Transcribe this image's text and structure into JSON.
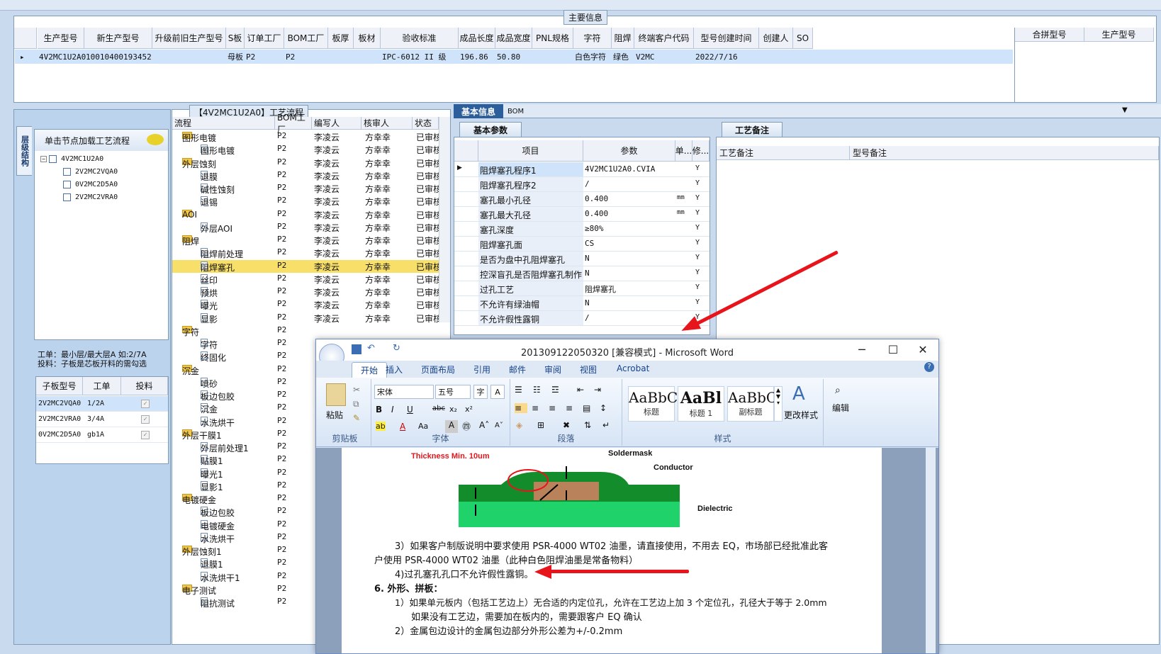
{
  "main_info": {
    "title": "主要信息",
    "columns": [
      "生产型号",
      "新生产型号",
      "升级前旧生产型号",
      "S板",
      "订单工厂",
      "BOM工厂",
      "板厚",
      "板材",
      "验收标准",
      "成品长度",
      "成品宽度",
      "PNL规格",
      "字符",
      "阻焊",
      "终端客户代码",
      "型号创建时间",
      "创建人",
      "SO"
    ],
    "row": {
      "marker": "▸",
      "生产型号": "4V2MC1U2A0",
      "新生产型号": "10010400193452",
      "S板": "母板",
      "订单工厂": "P2",
      "BOM工厂": "P2",
      "验收标准": "IPC-6012 II 级",
      "成品长度": "196.86",
      "成品宽度": "50.80",
      "字符": "白色字符",
      "阻焊": "绿色",
      "终端客户代码": "V2MC",
      "型号创建时间": "2022/7/16"
    },
    "right_columns": [
      "合拼型号",
      "生产型号"
    ]
  },
  "left": {
    "vertical_tab": "层级结构",
    "tree_header": "单击节点加载工艺流程",
    "tree": [
      "4V2MC1U2A0",
      "2V2MC2VQA0",
      "0V2MC2D5A0",
      "2V2MC2VRA0"
    ],
    "info_line1": "工单：最小层/最大层A 如:2/7A",
    "info_line2": "投料：子板是芯板开料的需勾选",
    "son_columns": [
      "子板型号",
      "工单",
      "投料"
    ],
    "son_rows": [
      {
        "model": "2V2MC2VQA0",
        "order": "1/2A",
        "check": "✓"
      },
      {
        "model": "2V2MC2VRA0",
        "order": "3/4A",
        "check": "✓"
      },
      {
        "model": "0V2MC2D5A0",
        "order": "gb1A",
        "check": "✓"
      }
    ]
  },
  "flow": {
    "title": "【4V2MC1U2A0】工艺流程",
    "columns": [
      "流程",
      "BOM工厂",
      "编写人",
      "核审人",
      "状态"
    ],
    "rows": [
      {
        "type": "folder",
        "name": "图形电镀",
        "bom": "P2",
        "writer": "李凌云",
        "reviewer": "方幸幸",
        "status": "已审核"
      },
      {
        "type": "doc",
        "name": "图形电镀",
        "bom": "P2",
        "writer": "李凌云",
        "reviewer": "方幸幸",
        "status": "已审核"
      },
      {
        "type": "folder",
        "name": "外层蚀刻",
        "bom": "P2",
        "writer": "李凌云",
        "reviewer": "方幸幸",
        "status": "已审核"
      },
      {
        "type": "doc",
        "name": "退膜",
        "bom": "P2",
        "writer": "李凌云",
        "reviewer": "方幸幸",
        "status": "已审核"
      },
      {
        "type": "doc",
        "name": "碱性蚀刻",
        "bom": "P2",
        "writer": "李凌云",
        "reviewer": "方幸幸",
        "status": "已审核"
      },
      {
        "type": "doc",
        "name": "退锡",
        "bom": "P2",
        "writer": "李凌云",
        "reviewer": "方幸幸",
        "status": "已审核"
      },
      {
        "type": "folder",
        "name": "AOI",
        "bom": "P2",
        "writer": "李凌云",
        "reviewer": "方幸幸",
        "status": "已审核"
      },
      {
        "type": "doc",
        "name": "外层AOI",
        "bom": "P2",
        "writer": "李凌云",
        "reviewer": "方幸幸",
        "status": "已审核"
      },
      {
        "type": "folder",
        "name": "阻焊",
        "bom": "P2",
        "writer": "李凌云",
        "reviewer": "方幸幸",
        "status": "已审核"
      },
      {
        "type": "doc",
        "name": "阻焊前处理",
        "bom": "P2",
        "writer": "李凌云",
        "reviewer": "方幸幸",
        "status": "已审核"
      },
      {
        "type": "doc",
        "name": "阻焊塞孔",
        "bom": "P2",
        "writer": "李凌云",
        "reviewer": "方幸幸",
        "status": "已审核",
        "selected": true
      },
      {
        "type": "doc",
        "name": "丝印",
        "bom": "P2",
        "writer": "李凌云",
        "reviewer": "方幸幸",
        "status": "已审核"
      },
      {
        "type": "doc",
        "name": "预烘",
        "bom": "P2",
        "writer": "李凌云",
        "reviewer": "方幸幸",
        "status": "已审核"
      },
      {
        "type": "doc",
        "name": "曝光",
        "bom": "P2",
        "writer": "李凌云",
        "reviewer": "方幸幸",
        "status": "已审核"
      },
      {
        "type": "doc",
        "name": "显影",
        "bom": "P2",
        "writer": "李凌云",
        "reviewer": "方幸幸",
        "status": "已审核"
      },
      {
        "type": "folder",
        "name": "字符",
        "bom": "P2"
      },
      {
        "type": "doc",
        "name": "字符",
        "bom": "P2"
      },
      {
        "type": "doc",
        "name": "终固化",
        "bom": "P2"
      },
      {
        "type": "folder",
        "name": "沉金",
        "bom": "P2"
      },
      {
        "type": "doc",
        "name": "喷砂",
        "bom": "P2"
      },
      {
        "type": "doc",
        "name": "板边包胶",
        "bom": "P2"
      },
      {
        "type": "doc",
        "name": "沉金",
        "bom": "P2"
      },
      {
        "type": "doc",
        "name": "水洗烘干",
        "bom": "P2"
      },
      {
        "type": "folder",
        "name": "外层干膜1",
        "bom": "P2"
      },
      {
        "type": "doc",
        "name": "外层前处理1",
        "bom": "P2"
      },
      {
        "type": "doc",
        "name": "贴膜1",
        "bom": "P2"
      },
      {
        "type": "doc",
        "name": "曝光1",
        "bom": "P2"
      },
      {
        "type": "doc",
        "name": "显影1",
        "bom": "P2"
      },
      {
        "type": "folder",
        "name": "电镀硬金",
        "bom": "P2"
      },
      {
        "type": "doc",
        "name": "板边包胶",
        "bom": "P2"
      },
      {
        "type": "doc",
        "name": "电镀硬金",
        "bom": "P2"
      },
      {
        "type": "doc",
        "name": "水洗烘干",
        "bom": "P2"
      },
      {
        "type": "folder",
        "name": "外层蚀刻1",
        "bom": "P2"
      },
      {
        "type": "doc",
        "name": "退膜1",
        "bom": "P2"
      },
      {
        "type": "doc",
        "name": "水洗烘干1",
        "bom": "P2"
      },
      {
        "type": "folder",
        "name": "电子测试",
        "bom": "P2"
      },
      {
        "type": "doc",
        "name": "阻抗测试",
        "bom": "P2"
      }
    ]
  },
  "params": {
    "tab_basic": "基本信息",
    "tab_bom": "BOM",
    "sub_tab": "基本参数",
    "columns": [
      "项目",
      "参数",
      "单...",
      "修..."
    ],
    "rows": [
      {
        "name": "阻焊塞孔程序1",
        "value": "4V2MC1U2A0.CVIA",
        "unit": "",
        "flag": "Y"
      },
      {
        "name": "阻焊塞孔程序2",
        "value": "/",
        "unit": "",
        "flag": "Y"
      },
      {
        "name": "塞孔最小孔径",
        "value": "0.400",
        "unit": "mm",
        "flag": "Y"
      },
      {
        "name": "塞孔最大孔径",
        "value": "0.400",
        "unit": "mm",
        "flag": "Y"
      },
      {
        "name": "塞孔深度",
        "value": "≥80%",
        "unit": "",
        "flag": "Y"
      },
      {
        "name": "阻焊塞孔面",
        "value": "CS",
        "unit": "",
        "flag": "Y"
      },
      {
        "name": "是否为盘中孔阻焊塞孔",
        "value": "N",
        "unit": "",
        "flag": "Y"
      },
      {
        "name": "控深盲孔是否阻焊塞孔制作",
        "value": "N",
        "unit": "",
        "flag": "Y"
      },
      {
        "name": "过孔工艺",
        "value": "阻焊塞孔",
        "unit": "",
        "flag": "Y"
      },
      {
        "name": "不允许有绿油帽",
        "value": "N",
        "unit": "",
        "flag": "Y"
      },
      {
        "name": "不允许假性露铜",
        "value": "/",
        "unit": "",
        "flag": "Y"
      }
    ],
    "memo_tab": "工艺备注",
    "memo_cols": [
      "工艺备注",
      "型号备注"
    ]
  },
  "word": {
    "title": "201309122050320 [兼容模式] - Microsoft Word",
    "tabs": [
      "开始",
      "插入",
      "页面布局",
      "引用",
      "邮件",
      "审阅",
      "视图",
      "Acrobat"
    ],
    "font_name": "宋体",
    "font_size": "五号",
    "groups": [
      "剪贴板",
      "字体",
      "段落",
      "样式",
      "编辑"
    ],
    "paste": "粘贴",
    "styles": [
      {
        "sample": "AaBbC",
        "name": "标题"
      },
      {
        "sample": "AaBl",
        "name": "标题 1"
      },
      {
        "sample": "AaBbC",
        "name": "副标题"
      }
    ],
    "change_style": "更改样式",
    "edit": "编辑",
    "figure": {
      "thickness": "Thickness Min. 10um",
      "soldermask": "Soldermask",
      "conductor": "Conductor",
      "dielectric": "Dielectric"
    },
    "lines": [
      "3）如果客户制版说明中要求使用 PSR-4000 WT02 油墨，请直接使用，不用去 EQ，市场部已经批准此客",
      "户使用 PSR-4000 WT02 油墨（此种白色阻焊油墨是常备物料）",
      "4)过孔塞孔孔口不允许假性露铜。",
      "6.   外形、拼板：",
      "1）如果单元板内（包括工艺边上）无合适的内定位孔，允许在工艺边上加 3 个定位孔，孔径大于等于 2.0mm",
      "如果没有工艺边，需要加在板内的，需要跟客户 EQ 确认",
      "2）金属包边设计的金属包边部分外形公差为+/-0.2mm"
    ]
  },
  "colors": {
    "accent": "#2c5e9c",
    "selected_row": "#f7df6a",
    "annotation_arrow": "#e8141b"
  }
}
